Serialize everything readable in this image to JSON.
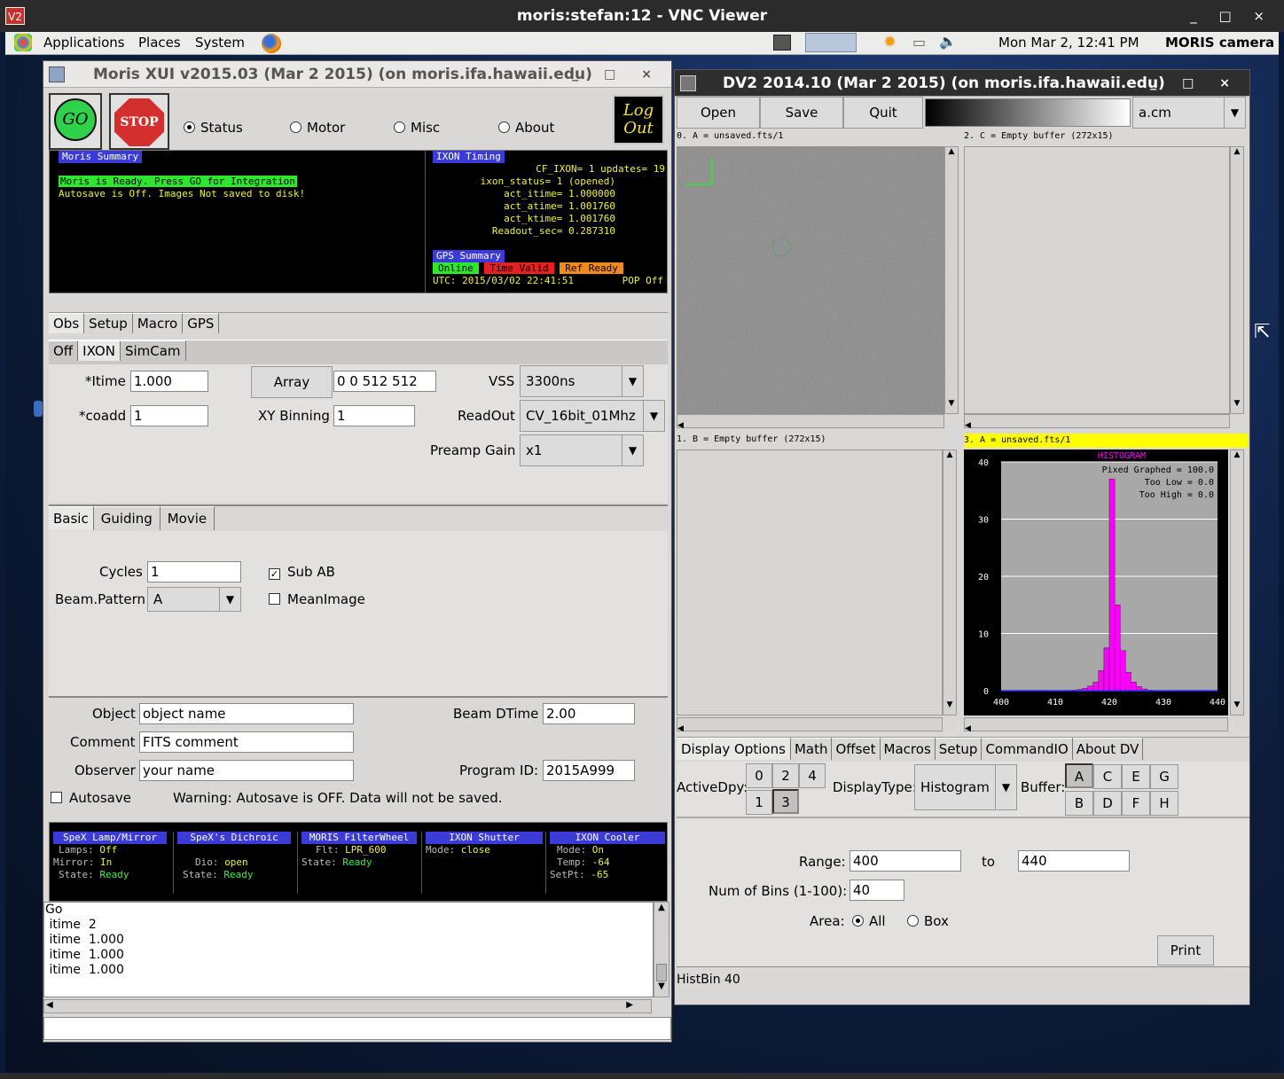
{
  "vnc": {
    "title": "moris:stefan:12 - VNC Viewer",
    "logo": "V2",
    "controls": "_ □ ×"
  },
  "panel": {
    "applications": "Applications",
    "places": "Places",
    "system": "System",
    "datetime": "Mon Mar  2, 12:41 PM",
    "user": "MORIS camera"
  },
  "xui": {
    "title": "Moris XUI v2015.03 (Mar  2 2015) (on moris.ifa.hawaii.edu)",
    "go": "GO",
    "stop": "STOP",
    "logout_1": "Log",
    "logout_2": "Out",
    "radios": {
      "status": "Status",
      "motor": "Motor",
      "misc": "Misc",
      "about": "About"
    },
    "summary": {
      "header": "Moris Summary",
      "line1": "Moris is Ready. Press GO for Integration",
      "line2": "Autosave is Off. Images Not saved to disk!"
    },
    "timing": {
      "header": "IXON Timing",
      "l1": "CF_IXON= 1  updates= 19",
      "l2": "ixon_status= 1 (opened)",
      "l3": "act_itime=  1.000000",
      "l4": "act_atime=  1.001760",
      "l5": "act_ktime=  1.001760",
      "l6": "Readout_sec=  0.287310"
    },
    "gps": {
      "header": "GPS Summary",
      "online": "Online",
      "time_valid": "Time Valid",
      "ref_ready": "Ref Ready",
      "utc": "UTC: 2015/03/02 22:41:51",
      "pop": "POP Off"
    },
    "tabs": [
      "Obs",
      "Setup",
      "Macro",
      "GPS"
    ],
    "cam_tabs": [
      "Off",
      "IXON",
      "SimCam"
    ],
    "itime_label": "*Itime",
    "itime": "1.000",
    "coadd_label": "*coadd",
    "coadd": "1",
    "array_btn": "Array",
    "array": "0 0 512 512",
    "xybin_label": "XY Binning",
    "xybin": "1",
    "vss_label": "VSS",
    "vss": "3300ns",
    "readout_label": "ReadOut",
    "readout": "CV_16bit_01Mhz",
    "preamp_label": "Preamp Gain",
    "preamp": "x1",
    "mode_tabs": [
      "Basic",
      "Guiding",
      "Movie"
    ],
    "cycles_label": "Cycles",
    "cycles": "1",
    "beam_label": "Beam.Pattern",
    "beam": "A",
    "subab": "Sub AB",
    "meanimage": "MeanImage",
    "object_label": "Object",
    "object": "object name",
    "comment_label": "Comment",
    "comment": "FITS comment",
    "observer_label": "Observer",
    "observer": "your name",
    "beamdtime_label": "Beam DTime",
    "beamdtime": "2.00",
    "program_label": "Program ID:",
    "program": "2015A999",
    "autosave": "Autosave",
    "warning": "Warning: Autosave is OFF. Data will not be saved.",
    "status": {
      "spex_lamp_h": "SpeX Lamp/Mirror",
      "lamps": "Lamps:",
      "lamps_v": "Off",
      "mirror": "Mirror:",
      "mirror_v": "In",
      "state1": "State:",
      "state1_v": "Ready",
      "dichroic_h": "SpeX's Dichroic",
      "dio": "Dio:",
      "dio_v": "open",
      "state2": "State:",
      "state2_v": "Ready",
      "filter_h": "MORIS FilterWheel",
      "flt": "Flt:",
      "flt_v": "LPR_600",
      "state3": "State:",
      "state3_v": "Ready",
      "shutter_h": "IXON Shutter",
      "mode1": "Mode:",
      "mode1_v": "close",
      "cooler_h": "IXON Cooler",
      "mode2": "Mode:",
      "mode2_v": "On",
      "temp": "Temp:",
      "temp_v": "-64",
      "setpt": "SetPt:",
      "setpt_v": "-65"
    },
    "log": [
      "Go",
      " itime  2",
      " itime  1.000",
      " itime  1.000",
      " itime  1.000"
    ]
  },
  "dv": {
    "title": "DV2 2014.10 (Mar  2 2015) (on moris.ifa.hawaii.edu)",
    "open": "Open",
    "save": "Save",
    "quit": "Quit",
    "cmap": "a.cm",
    "buf0": "0. A = unsaved.fts/1",
    "buf2": "2. C = Empty buffer (272x15)",
    "buf1": "1. B = Empty buffer (272x15)",
    "buf3": "3. A = unsaved.fts/1",
    "tabs": [
      "Display Options",
      "Math",
      "Offset",
      "Macros",
      "Setup",
      "CommandIO",
      "About DV"
    ],
    "activedpy": "ActiveDpy:",
    "displaytype_label": "DisplayType:",
    "displaytype": "Histogram",
    "buffer_label": "Buffer:",
    "range_label": "Range:",
    "range_lo": "400",
    "to": "to",
    "range_hi": "440",
    "bins_label": "Num of Bins (1-100):",
    "bins": "40",
    "area_label": "Area:",
    "area_all": "All",
    "area_box": "Box",
    "print": "Print",
    "status": "HistBin 40"
  },
  "chart_data": {
    "type": "bar",
    "title": "HISTOGRAM",
    "annotations": [
      "Pixed Graphed = 100.0",
      "Too Low =   0.0",
      "Too High =   0.0"
    ],
    "xlim": [
      400,
      440
    ],
    "ylim": [
      0,
      40
    ],
    "xticks": [
      "400",
      "410",
      "420",
      "430",
      "440"
    ],
    "yticks": [
      "0",
      "10",
      "20",
      "30",
      "40"
    ],
    "x": [
      413,
      414,
      415,
      416,
      417,
      418,
      419,
      420,
      421,
      422,
      423,
      424,
      425,
      426,
      427
    ],
    "values": [
      0.1,
      0.2,
      0.4,
      0.8,
      1.5,
      3.5,
      7.5,
      37,
      15,
      7,
      3.2,
      1.5,
      0.7,
      0.3,
      0.1
    ],
    "colors": {
      "bar": "#ff00ff",
      "bg": "#a8a8a8",
      "frame": "#000000"
    }
  }
}
